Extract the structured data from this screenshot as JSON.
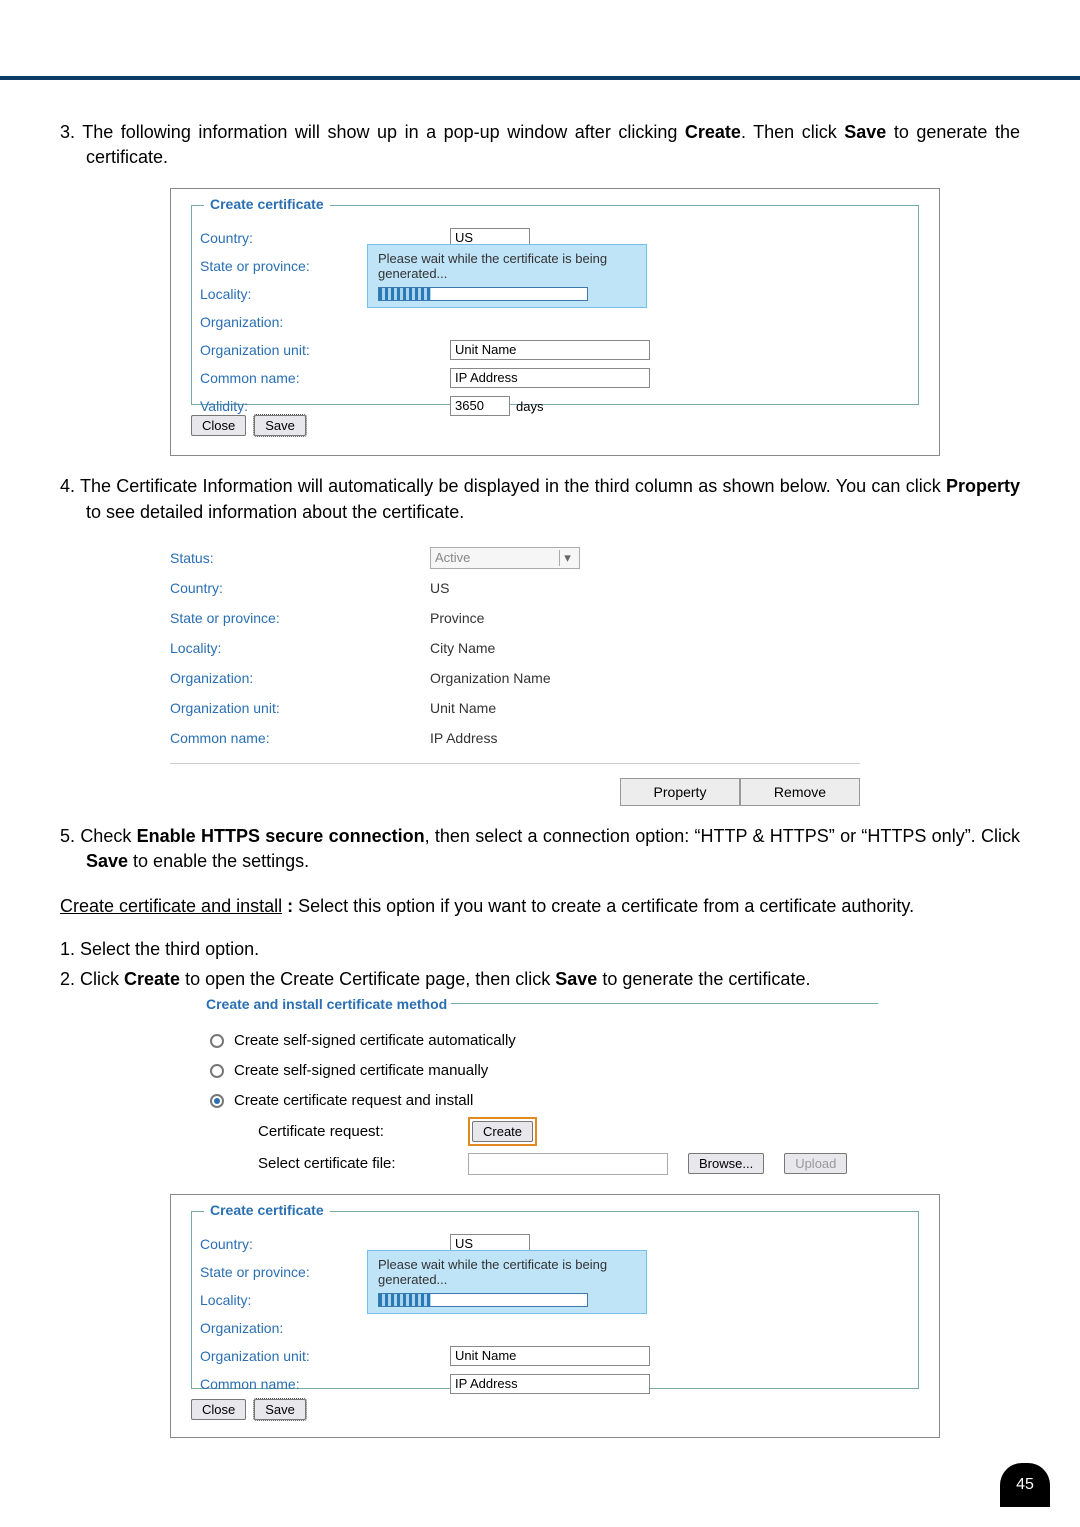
{
  "step3": {
    "num": "3.",
    "text_a": "The following information will show up in a pop-up window after clicking ",
    "bold1": "Create",
    "text_b": ". Then click ",
    "bold2": "Save",
    "text_c": " to generate the certificate."
  },
  "create_dialog1": {
    "legend": "Create certificate",
    "labels": {
      "country": "Country:",
      "state": "State or province:",
      "locality": "Locality:",
      "org": "Organization:",
      "orgunit": "Organization unit:",
      "common": "Common name:",
      "validity": "Validity:"
    },
    "values": {
      "country": "US",
      "orgunit": "Unit Name",
      "common": "IP Address",
      "validity": "3650",
      "days": "days"
    },
    "waitmsg": "Please wait while the certificate is being generated...",
    "close": "Close",
    "save": "Save"
  },
  "step4": {
    "num": "4.",
    "text_a": "The Certificate Information will automatically be displayed in the third column as shown below. You can click ",
    "bold1": "Property",
    "text_b": " to see detailed information about the certificate."
  },
  "info": {
    "labels": {
      "status": "Status:",
      "country": "Country:",
      "state": "State or province:",
      "locality": "Locality:",
      "org": "Organization:",
      "orgunit": "Organization unit:",
      "common": "Common name:"
    },
    "values": {
      "status": "Active",
      "country": "US",
      "state": "Province",
      "locality": "City Name",
      "org": "Organization Name",
      "orgunit": "Unit Name",
      "common": "IP Address"
    },
    "property_btn": "Property",
    "remove_btn": "Remove"
  },
  "step5": {
    "num": "5.",
    "text_a": "Check ",
    "bold1": "Enable HTTPS secure connection",
    "text_b": ", then select a connection option: “HTTP & HTTPS” or “HTTPS only”. Click ",
    "bold2": "Save",
    "text_c": " to enable the settings."
  },
  "subheading": {
    "title": "Create certificate and install",
    "sep": " : ",
    "text": "Select this option if you want to create a certificate from a certificate authority."
  },
  "stepA": {
    "num": "1.",
    "text": "Select the third option."
  },
  "stepB": {
    "num": "2.",
    "text_a": "Click ",
    "bold1": "Create",
    "text_b": " to open the Create Certificate page, then click ",
    "bold2": "Save",
    "text_c": " to generate the certificate."
  },
  "method": {
    "legend": "Create and install certificate method",
    "opt1": "Create self-signed certificate automatically",
    "opt2": "Create self-signed certificate manually",
    "opt3": "Create certificate request and install",
    "cert_req_lbl": "Certificate request:",
    "create_btn": "Create",
    "select_file_lbl": "Select certificate file:",
    "browse_btn": "Browse...",
    "upload_btn": "Upload"
  },
  "create_dialog2": {
    "legend": "Create certificate",
    "labels": {
      "country": "Country:",
      "state": "State or province:",
      "locality": "Locality:",
      "org": "Organization:",
      "orgunit": "Organization unit:",
      "common": "Common name:"
    },
    "values": {
      "country": "US",
      "orgunit": "Unit Name",
      "common": "IP Address"
    },
    "waitmsg": "Please wait while the certificate is being generated...",
    "close": "Close",
    "save": "Save"
  },
  "pagenum": "45"
}
